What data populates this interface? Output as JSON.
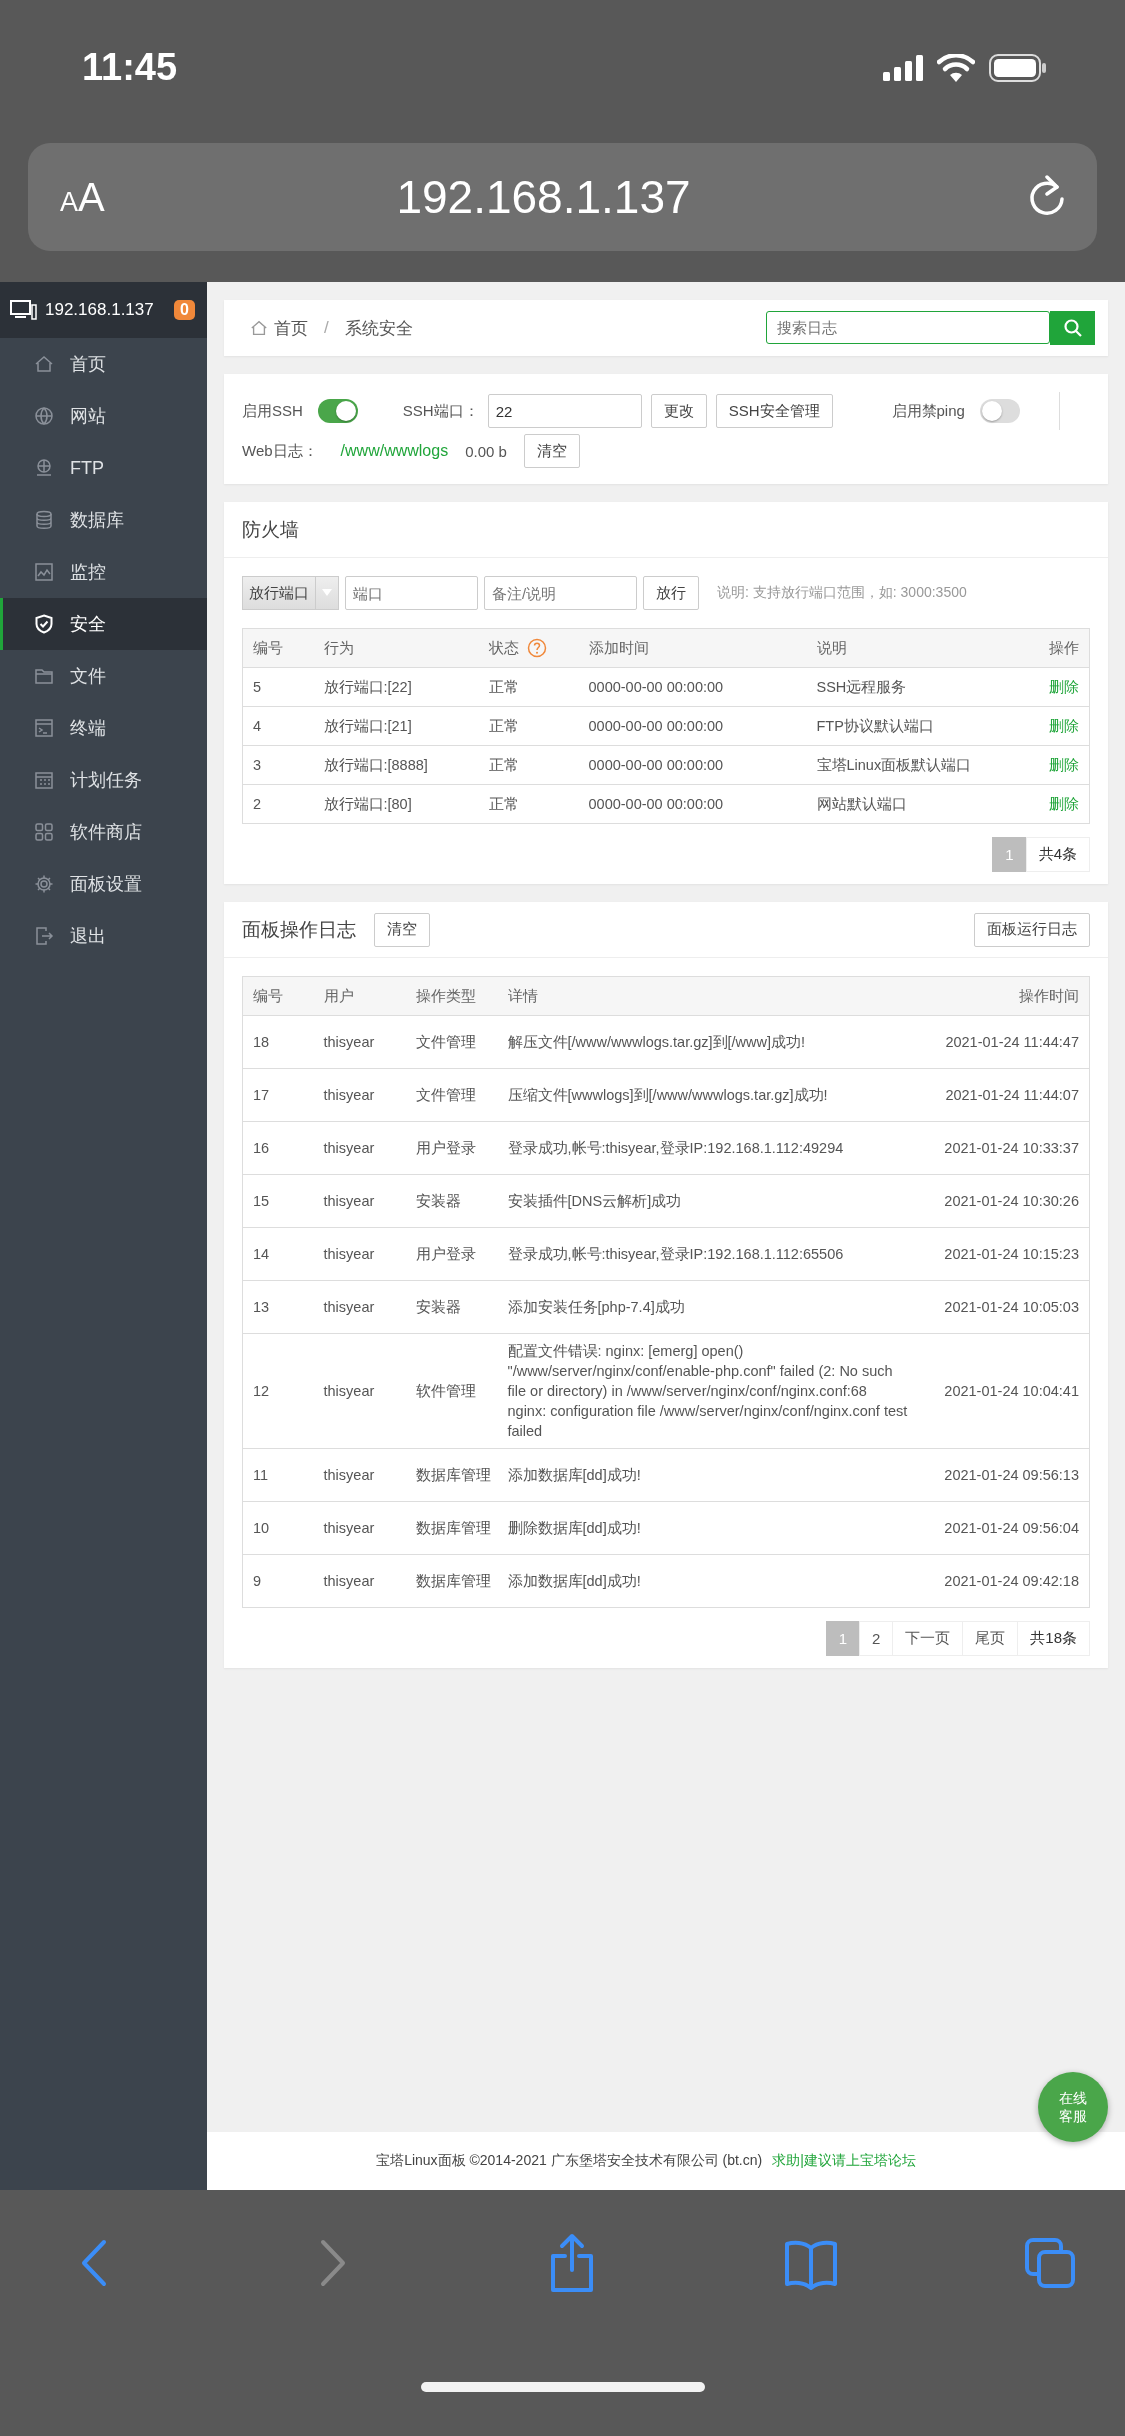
{
  "status_bar": {
    "time": "11:45"
  },
  "browser": {
    "text_size": "AA",
    "url": "192.168.1.137"
  },
  "sidebar": {
    "host": "192.168.1.137",
    "badge": "0",
    "items": [
      {
        "label": "首页",
        "selected": false
      },
      {
        "label": "网站",
        "selected": false
      },
      {
        "label": "FTP",
        "selected": false
      },
      {
        "label": "数据库",
        "selected": false
      },
      {
        "label": "监控",
        "selected": false
      },
      {
        "label": "安全",
        "selected": true
      },
      {
        "label": "文件",
        "selected": false
      },
      {
        "label": "终端",
        "selected": false
      },
      {
        "label": "计划任务",
        "selected": false
      },
      {
        "label": "软件商店",
        "selected": false
      },
      {
        "label": "面板设置",
        "selected": false
      },
      {
        "label": "退出",
        "selected": false
      }
    ]
  },
  "breadcrumb": [
    "首页",
    "系统安全"
  ],
  "breadcrumb_separator": "/",
  "search": {
    "placeholder": "搜索日志"
  },
  "settings": {
    "ssh": {
      "label": "启用SSH",
      "on": true
    },
    "port_label": "SSH端口：",
    "port": "22",
    "port_buttons": [
      "更改",
      "SSH安全管理"
    ],
    "ping": {
      "label": "启用禁ping",
      "on": false
    },
    "weblog_label": "Web日志：",
    "weblog_path": "/www/wwwlogs",
    "weblog_size": "0.00 b",
    "clear": "清空"
  },
  "firewall": {
    "title": "防火墙",
    "select": "放行端口",
    "port_placeholder": "端口",
    "note_placeholder": "备注/说明",
    "submit": "放行",
    "hint": "说明: 支持放行端口范围，如: 3000:3500",
    "columns": [
      "编号",
      "行为",
      "状态",
      "添加时间",
      "说明",
      "操作"
    ],
    "rows": [
      {
        "cells": [
          "5",
          "放行端口:[22]",
          "正常",
          "0000-00-00 00:00:00",
          "SSH远程服务"
        ],
        "action": "删除"
      },
      {
        "cells": [
          "4",
          "放行端口:[21]",
          "正常",
          "0000-00-00 00:00:00",
          "FTP协议默认端口"
        ],
        "action": "删除"
      },
      {
        "cells": [
          "3",
          "放行端口:[8888]",
          "正常",
          "0000-00-00 00:00:00",
          "宝塔Linux面板默认端口"
        ],
        "action": "删除"
      },
      {
        "cells": [
          "2",
          "放行端口:[80]",
          "正常",
          "0000-00-00 00:00:00",
          "网站默认端口"
        ],
        "action": "删除"
      }
    ],
    "pagination": {
      "pages": [
        {
          "label": "1",
          "selected": true
        }
      ],
      "total": "共4条"
    }
  },
  "logs": {
    "title": "面板操作日志",
    "clear": "清空",
    "run_log": "面板运行日志",
    "columns": [
      "编号",
      "用户",
      "操作类型",
      "详情",
      "操作时间"
    ],
    "rows": [
      [
        "18",
        "thisyear",
        "文件管理",
        "解压文件[/www/wwwlogs.tar.gz]到[/www]成功!",
        "2021-01-24 11:44:47"
      ],
      [
        "17",
        "thisyear",
        "文件管理",
        "压缩文件[wwwlogs]到[/www/wwwlogs.tar.gz]成功!",
        "2021-01-24 11:44:07"
      ],
      [
        "16",
        "thisyear",
        "用户登录",
        "登录成功,帐号:thisyear,登录IP:192.168.1.112:49294",
        "2021-01-24 10:33:37"
      ],
      [
        "15",
        "thisyear",
        "安装器",
        "安装插件[DNS云解析]成功",
        "2021-01-24 10:30:26"
      ],
      [
        "14",
        "thisyear",
        "用户登录",
        "登录成功,帐号:thisyear,登录IP:192.168.1.112:65506",
        "2021-01-24 10:15:23"
      ],
      [
        "13",
        "thisyear",
        "安装器",
        "添加安装任务[php-7.4]成功",
        "2021-01-24 10:05:03"
      ],
      [
        "12",
        "thisyear",
        "软件管理",
        "配置文件错误: nginx: [emerg] open() \"/www/server/nginx/conf/enable-php.conf\" failed (2: No such file or directory) in /www/server/nginx/conf/nginx.conf:68 nginx: configuration file /www/server/nginx/conf/nginx.conf test failed",
        "2021-01-24 10:04:41"
      ],
      [
        "11",
        "thisyear",
        "数据库管理",
        "添加数据库[dd]成功!",
        "2021-01-24 09:56:13"
      ],
      [
        "10",
        "thisyear",
        "数据库管理",
        "删除数据库[dd]成功!",
        "2021-01-24 09:56:04"
      ],
      [
        "9",
        "thisyear",
        "数据库管理",
        "添加数据库[dd]成功!",
        "2021-01-24 09:42:18"
      ]
    ],
    "pagination": {
      "pages": [
        {
          "label": "1",
          "selected": true
        },
        {
          "label": "2",
          "selected": false
        },
        {
          "label": "下一页",
          "selected": false
        },
        {
          "label": "尾页",
          "selected": false
        }
      ],
      "total": "共18条"
    }
  },
  "footer": {
    "text": "宝塔Linux面板 ©2014-2021 广东堡塔安全技术有限公司 (bt.cn)",
    "link": "求助|建议请上宝塔论坛"
  },
  "chat": "在线客服",
  "toolbar": [
    {
      "kind": "back",
      "disabled": false
    },
    {
      "kind": "forward",
      "disabled": true
    },
    {
      "kind": "share",
      "disabled": false
    },
    {
      "kind": "bookmarks",
      "disabled": false
    },
    {
      "kind": "tabs",
      "disabled": false
    }
  ]
}
